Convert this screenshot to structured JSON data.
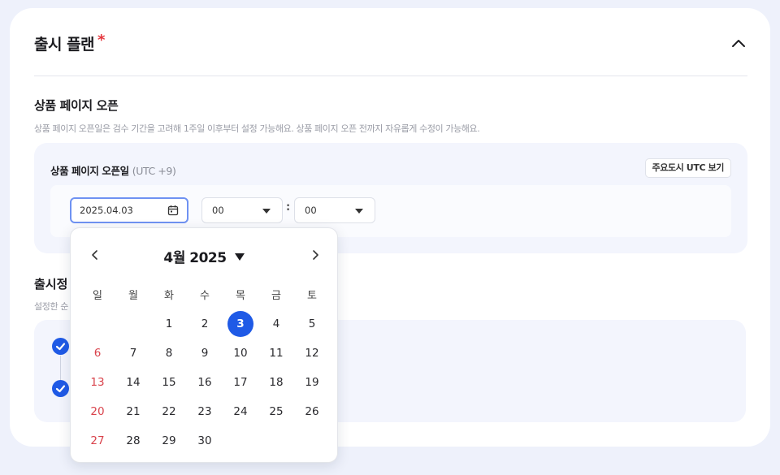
{
  "release_plan": {
    "title": "출시 플랜",
    "required_mark": "*",
    "collapse_icon": "chevron-up-icon"
  },
  "page_open": {
    "title": "상품 페이지 오픈",
    "description": "상품 페이지 오픈일은 검수 기간을 고려해 1주일 이후부터 설정 가능해요. 상품 페이지 오픈 전까지 자유롭게 수정이 가능해요.",
    "date_label": "상품 페이지 오픈일",
    "timezone": "(UTC +9)",
    "utc_button": "주요도시 UTC 보기",
    "date_value": "2025.04.03",
    "hour_value": "00",
    "minute_value": "00",
    "time_separator": ":"
  },
  "release_policy": {
    "title_visible": "출시정",
    "desc_visible": "설정한 순"
  },
  "calendar": {
    "month_title": "4월 2025",
    "weekdays": [
      "일",
      "월",
      "화",
      "수",
      "목",
      "금",
      "토"
    ],
    "weeks": [
      [
        "",
        "",
        "1",
        "2",
        "3",
        "4",
        "5"
      ],
      [
        "6",
        "7",
        "8",
        "9",
        "10",
        "11",
        "12"
      ],
      [
        "13",
        "14",
        "15",
        "16",
        "17",
        "18",
        "19"
      ],
      [
        "20",
        "21",
        "22",
        "23",
        "24",
        "25",
        "26"
      ],
      [
        "27",
        "28",
        "29",
        "30",
        "",
        "",
        ""
      ]
    ],
    "selected_day": "3",
    "colors": {
      "selected": "#1f5ae6",
      "sunday": "#d9434c"
    }
  },
  "colors": {
    "accent": "#1f5ae6",
    "required": "#e5363d",
    "background": "#eef1fb"
  }
}
